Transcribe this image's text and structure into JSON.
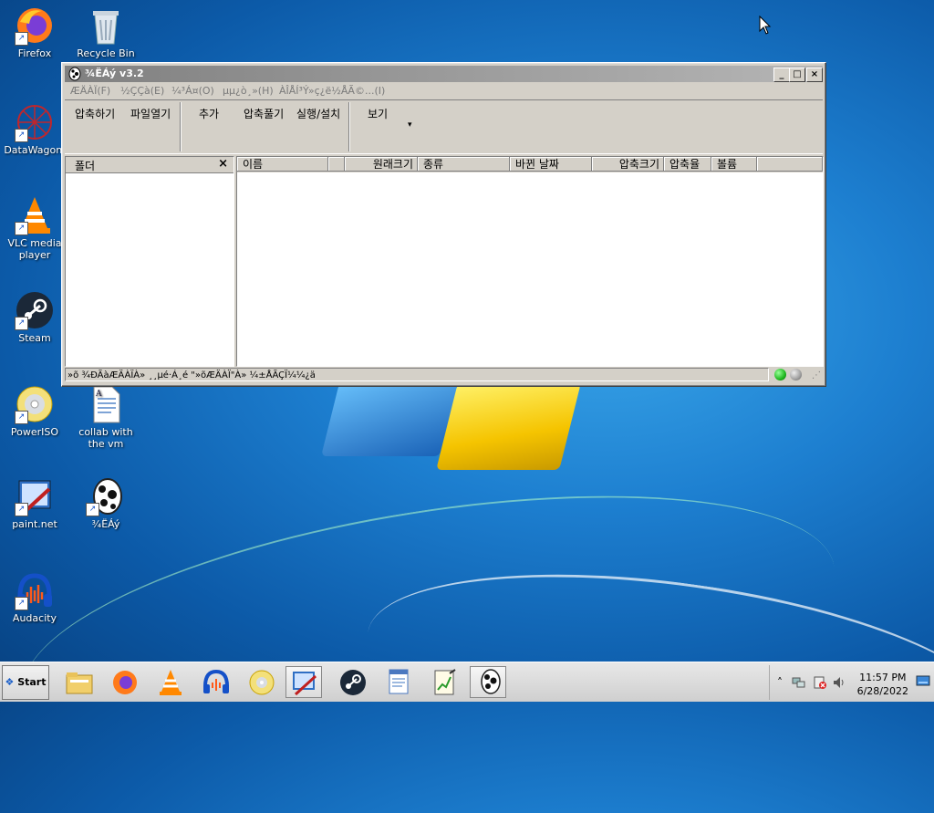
{
  "desktop": {
    "icons": [
      {
        "label": "Firefox"
      },
      {
        "label": "Recycle Bin"
      },
      {
        "label": "DataWagon."
      },
      {
        "label": "VLC media player"
      },
      {
        "label": "Steam"
      },
      {
        "label": "PowerISO"
      },
      {
        "label": "collab with the vm"
      },
      {
        "label": "paint.net"
      },
      {
        "label": "¾ËÁý"
      },
      {
        "label": "Audacity"
      }
    ]
  },
  "window": {
    "title": "¾ËÁý v3.2",
    "controls": {
      "minimize": "_",
      "maximize": "□",
      "close": "×"
    },
    "menu": [
      {
        "label": "ÆÄÀÏ(F)"
      },
      {
        "label": "½ÇÇà(E)"
      },
      {
        "label": "¼³Á¤(O)"
      },
      {
        "label": "µµ¿ò¸»(H)"
      },
      {
        "label": "ÀÎÅÍ³Ý»ç¿ë½ÅÃ©...(I)"
      }
    ],
    "toolbar": [
      {
        "label": "압축하기"
      },
      {
        "label": "파일열기"
      },
      {
        "label": "추가"
      },
      {
        "label": "압축풀기"
      },
      {
        "label": "실행/설치"
      },
      {
        "label": "보기"
      }
    ],
    "view_dropdown_arrow": "▾",
    "folder_pane": {
      "title": "폴더",
      "close": "×"
    },
    "columns": [
      {
        "label": "이름"
      },
      {
        "label": ""
      },
      {
        "label": "원래크기"
      },
      {
        "label": "종류"
      },
      {
        "label": "바뀐 날짜"
      },
      {
        "label": "압축크기"
      },
      {
        "label": "압축율"
      },
      {
        "label": "볼륨"
      }
    ],
    "status_text": "»õ ¾ÐÃàÆÄÀÏÀ» ¸¸µé·Á¸é \"»õÆÄÀÏ\"À» ¼±ÅÃÇÏ¼¼¿ä",
    "status_leds": {
      "left": "#1fb81f",
      "right": "#a0a0a0"
    }
  },
  "taskbar": {
    "start_label": "Start",
    "pinned": [
      {
        "icon": "explorer-icon"
      },
      {
        "icon": "firefox-icon"
      },
      {
        "icon": "vlc-icon"
      },
      {
        "icon": "audacity-icon"
      },
      {
        "icon": "poweriso-icon"
      },
      {
        "icon": "paintnet-icon"
      },
      {
        "icon": "steam-icon"
      },
      {
        "icon": "wordpad-icon"
      },
      {
        "icon": "notepad-icon"
      },
      {
        "icon": "alzip-icon"
      }
    ],
    "clock": {
      "time": "11:57 PM",
      "date": "6/28/2022"
    },
    "tray_expand": "˄"
  }
}
